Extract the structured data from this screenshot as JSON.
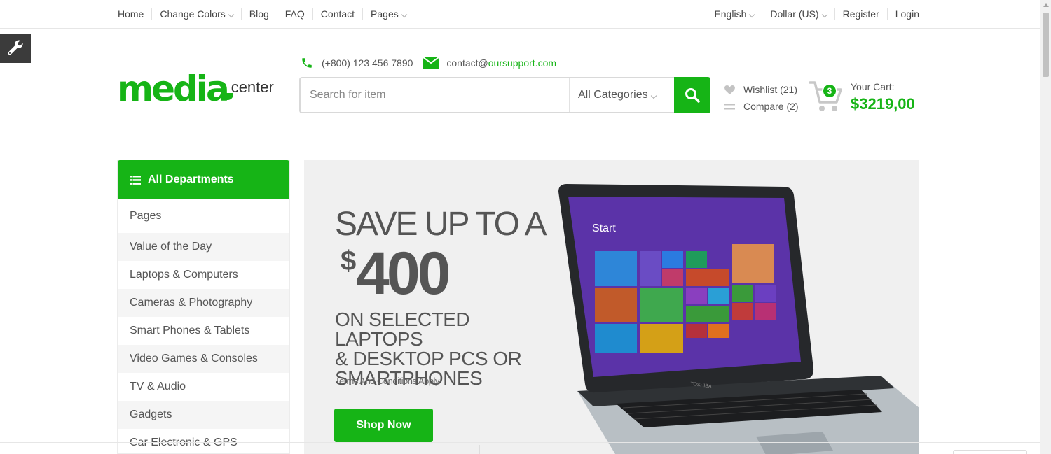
{
  "topbar": {
    "left": [
      {
        "label": "Home",
        "dropdown": false
      },
      {
        "label": "Change Colors",
        "dropdown": true
      },
      {
        "label": "Blog",
        "dropdown": false
      },
      {
        "label": "FAQ",
        "dropdown": false
      },
      {
        "label": "Contact",
        "dropdown": false
      },
      {
        "label": "Pages",
        "dropdown": true
      }
    ],
    "right": [
      {
        "label": "English",
        "dropdown": true
      },
      {
        "label": "Dollar (US)",
        "dropdown": true
      },
      {
        "label": "Register",
        "dropdown": false
      },
      {
        "label": "Login",
        "dropdown": false
      }
    ]
  },
  "logo": {
    "primary": "media",
    "secondary": "center"
  },
  "contact": {
    "phone": "(+800) 123 456 7890",
    "email_user": "contact@",
    "email_domain": "oursupport.com"
  },
  "search": {
    "placeholder": "Search for item",
    "category": "All Categories"
  },
  "wishlist": {
    "label": "Wishlist (21)"
  },
  "compare": {
    "label": "Compare (2)"
  },
  "cart": {
    "count": "3",
    "label": "Your Cart:",
    "total": "$3219,00"
  },
  "departments": {
    "title": "All Departments",
    "items": [
      "Pages",
      "Value of the Day",
      "Laptops & Computers",
      "Cameras & Photography",
      "Smart Phones & Tablets",
      "Video Games & Consoles",
      "TV & Audio",
      "Gadgets",
      "Car Electronic & GPS"
    ]
  },
  "hero": {
    "headline": "SAVE UP TO A",
    "currency": "$",
    "amount": "400",
    "subline_1": "ON SELECTED LAPTOPS",
    "subline_2": "& DESKTOP PCS OR",
    "subline_3": "SMARTPHONES",
    "terms": "Terms And Conditions Apply",
    "cta": "Shop Now",
    "screen_text": "Start",
    "brand_text": "TOSHIBA"
  },
  "colors": {
    "accent": "#16b416",
    "text": "#555555",
    "sidebar_alt": "#f5f5f5",
    "banner_bg": "#f0f0f0"
  }
}
